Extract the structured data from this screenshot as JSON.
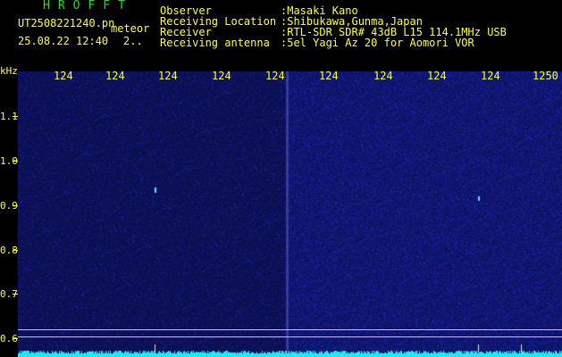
{
  "header": {
    "logo": "HROFFT",
    "filename": "UT2508221240.pn",
    "meteor_label": "meteor",
    "datetime": "25.08.22 12:40",
    "count": "2..",
    "info_labels": [
      "Observer",
      "Receiving Location",
      "Receiver",
      "Receiving antenna"
    ],
    "info_values": [
      ":Masaki Kano",
      ":Shibukawa,Gunma,Japan",
      ":RTL-SDR SDR# 43dB L15 114.1MHz USB",
      ":5el Yagi Az 20 for Aomori VOR"
    ]
  },
  "axis": {
    "y_unit": "kHz",
    "y_ticks": [
      "1.1",
      "1.0",
      "0.9",
      "0.8",
      "0.7",
      "0.6"
    ],
    "x_ticks": [
      "124",
      "124",
      "124",
      "124",
      "124",
      "124",
      "124",
      "124",
      "124",
      "1250"
    ]
  },
  "colors": {
    "background": "#000000",
    "label_green": "#2bd82b",
    "label_yellow": "#ffff3a",
    "spectrum_base": "#060c3a",
    "noise_floor": "#27e6f0"
  }
}
